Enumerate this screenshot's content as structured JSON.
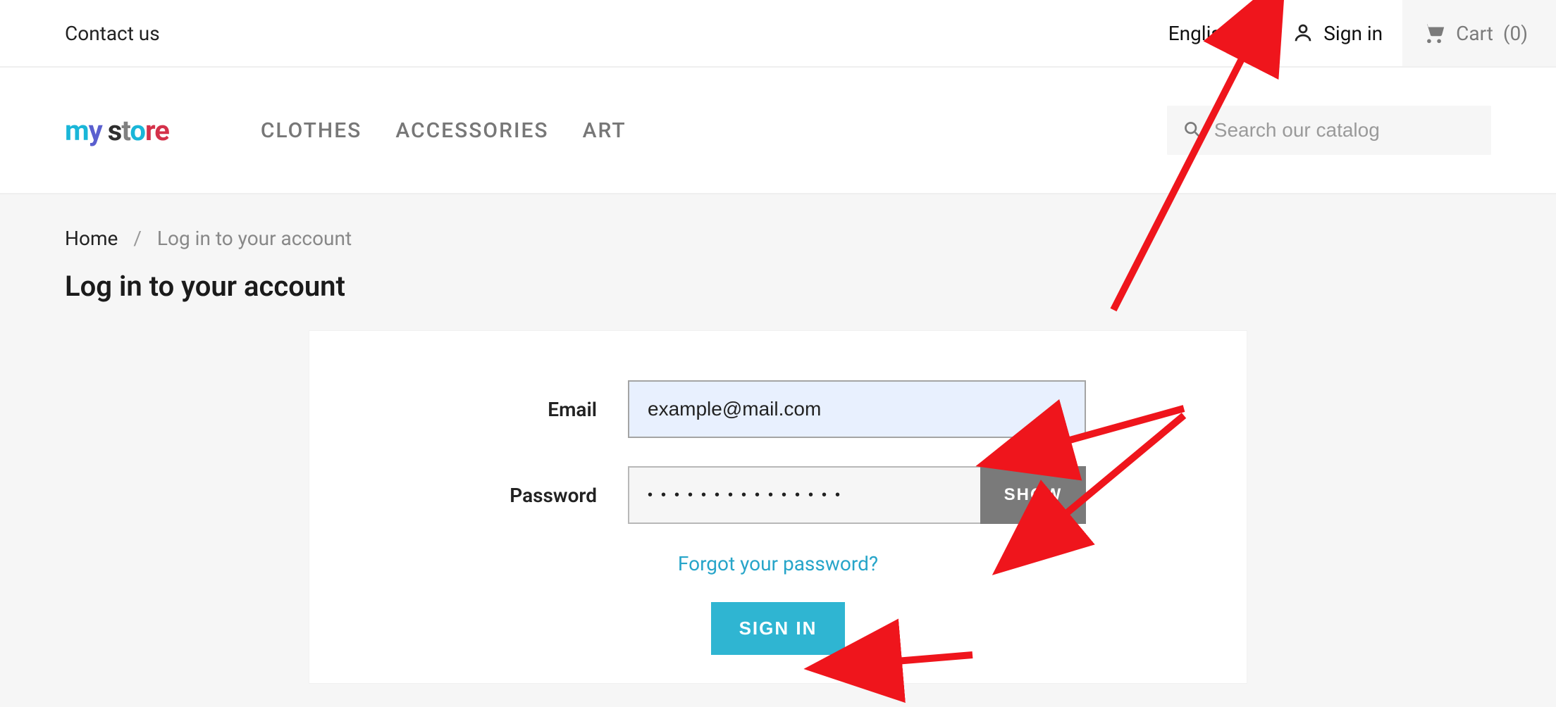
{
  "topnav": {
    "contact": "Contact us",
    "language": "English",
    "signin": "Sign in",
    "cart_label": "Cart",
    "cart_count": "(0)"
  },
  "logo": {
    "text": "my store"
  },
  "mainnav": {
    "items": [
      "CLOTHES",
      "ACCESSORIES",
      "ART"
    ]
  },
  "search": {
    "placeholder": "Search our catalog"
  },
  "breadcrumb": {
    "home": "Home",
    "current": "Log in to your account"
  },
  "page": {
    "title": "Log in to your account"
  },
  "form": {
    "email_label": "Email",
    "email_value": "example@mail.com",
    "password_label": "Password",
    "password_value": "•••••••••••••••",
    "show_label": "SHOW",
    "forgot_label": "Forgot your password?",
    "submit_label": "SIGN IN"
  },
  "colors": {
    "accent": "#2fb5d2",
    "red": "#ef151c"
  }
}
